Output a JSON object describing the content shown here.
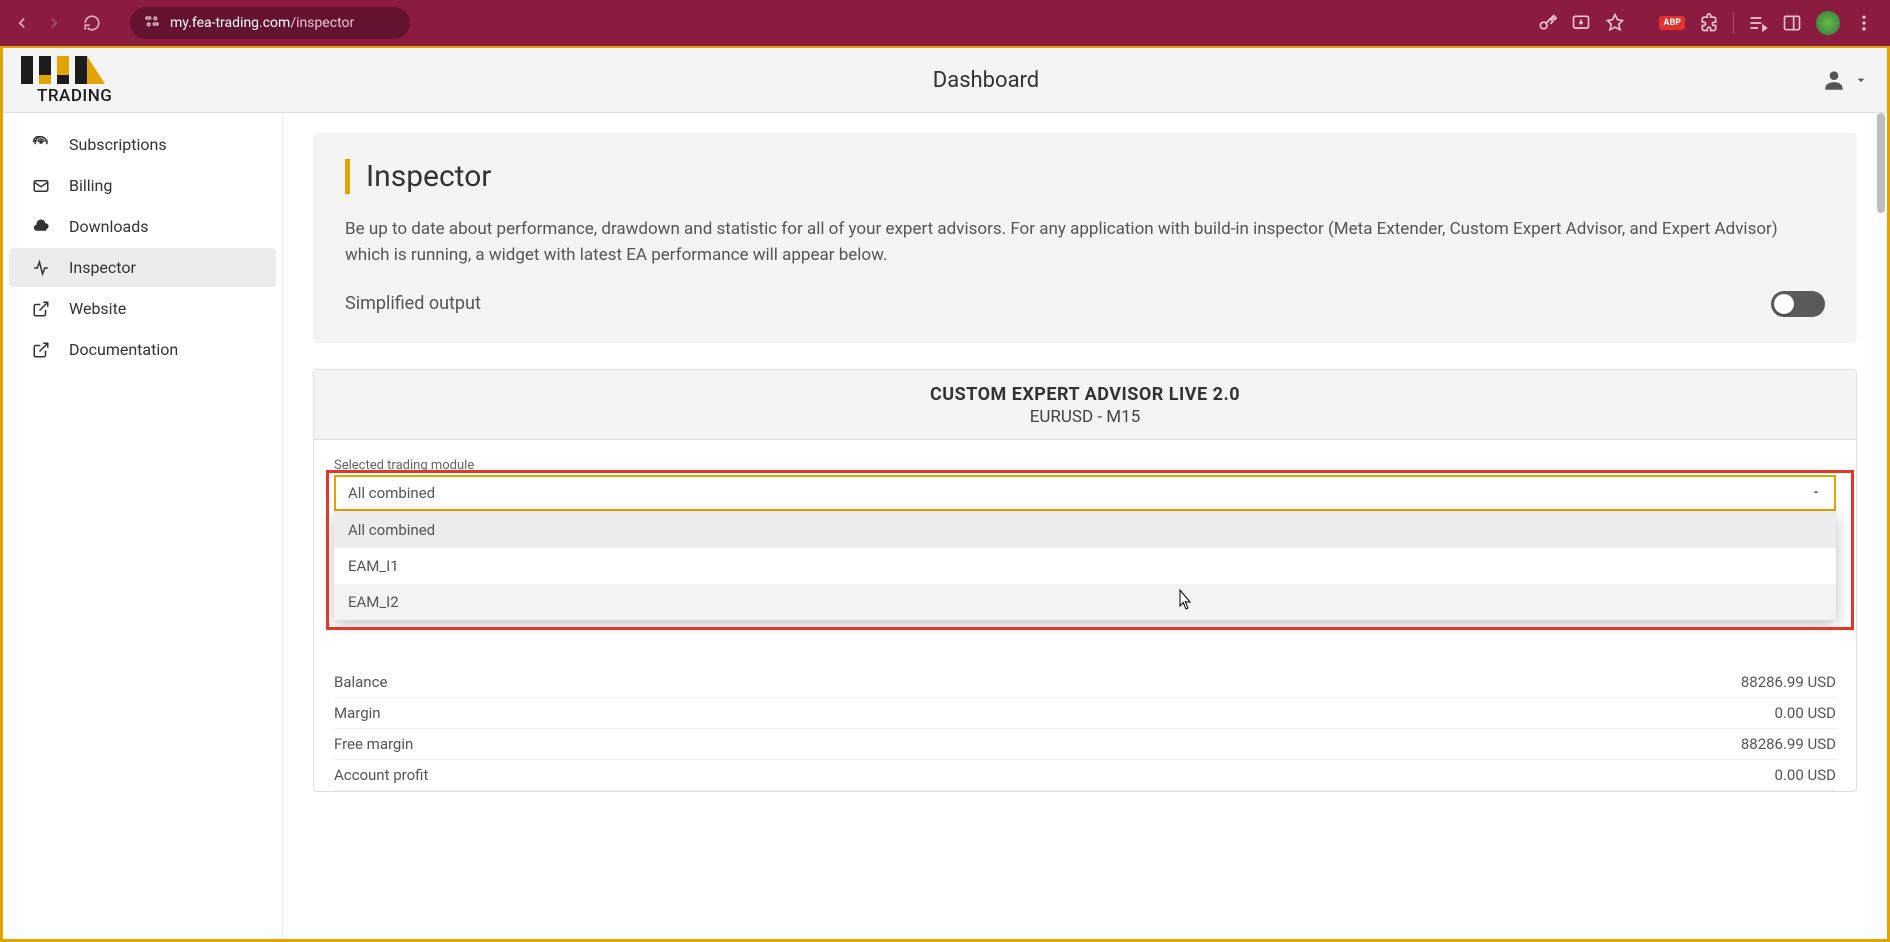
{
  "browser": {
    "url_prefix": "my.fea-trading.com",
    "url_path": "/inspector"
  },
  "topbar": {
    "logo_text": "TRADING",
    "title": "Dashboard"
  },
  "sidebar": {
    "items": [
      {
        "icon": "antenna",
        "label": "Subscriptions"
      },
      {
        "icon": "mail",
        "label": "Billing"
      },
      {
        "icon": "cloud-down",
        "label": "Downloads"
      },
      {
        "icon": "activity",
        "label": "Inspector",
        "active": true
      },
      {
        "icon": "open",
        "label": "Website"
      },
      {
        "icon": "open",
        "label": "Documentation"
      }
    ]
  },
  "inspector": {
    "title": "Inspector",
    "description": "Be up to date about performance, drawdown and statistic for all of your expert advisors. For any application with build-in inspector (Meta Extender, Custom Expert Advisor, and Expert Advisor) which is running, a widget with latest EA performance will appear below.",
    "simplified_label": "Simplified output"
  },
  "ea": {
    "title": "CUSTOM EXPERT ADVISOR LIVE 2.0",
    "subtitle": "EURUSD - M15",
    "select_label": "Selected trading module",
    "select_value": "All combined",
    "options": [
      "All combined",
      "EAM_I1",
      "EAM_I2"
    ],
    "stats": [
      {
        "k": "Balance",
        "v": "88286.99 USD"
      },
      {
        "k": "Margin",
        "v": "0.00 USD"
      },
      {
        "k": "Free margin",
        "v": "88286.99 USD"
      },
      {
        "k": "Account profit",
        "v": "0.00 USD"
      }
    ]
  }
}
